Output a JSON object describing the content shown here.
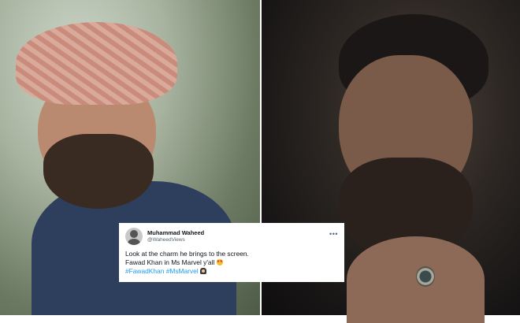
{
  "tweet": {
    "display_name": "Muhammad Waheed",
    "handle": "@WaheedViews",
    "more_icon": "more-options-icon",
    "line1": "Look at the charm he brings to the screen.",
    "line2_text": "Fawad Khan in Ms Marvel y'all",
    "line2_emoji": "star-struck-emoji",
    "hashtag1": "#FawadKhan",
    "hashtag2": "#MsMarvel",
    "line3_emoji": "woman-emoji",
    "hashtag_color": "#1d9bf0"
  },
  "photos": {
    "left": "turban-man-smiling",
    "right": "bearded-man-with-ring"
  }
}
